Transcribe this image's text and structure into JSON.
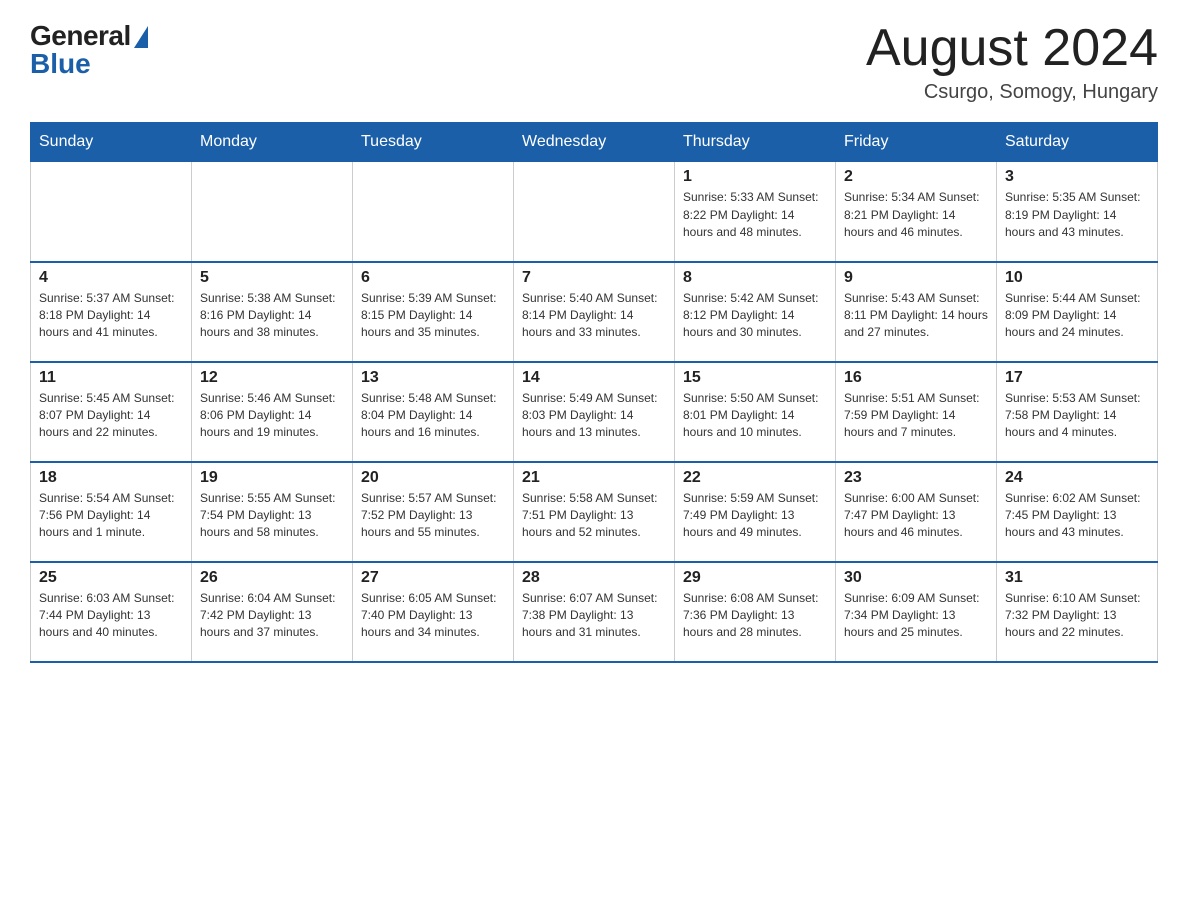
{
  "logo": {
    "general": "General",
    "blue": "Blue"
  },
  "header": {
    "month": "August 2024",
    "location": "Csurgo, Somogy, Hungary"
  },
  "weekdays": [
    "Sunday",
    "Monday",
    "Tuesday",
    "Wednesday",
    "Thursday",
    "Friday",
    "Saturday"
  ],
  "weeks": [
    [
      {
        "day": "",
        "info": ""
      },
      {
        "day": "",
        "info": ""
      },
      {
        "day": "",
        "info": ""
      },
      {
        "day": "",
        "info": ""
      },
      {
        "day": "1",
        "info": "Sunrise: 5:33 AM\nSunset: 8:22 PM\nDaylight: 14 hours\nand 48 minutes."
      },
      {
        "day": "2",
        "info": "Sunrise: 5:34 AM\nSunset: 8:21 PM\nDaylight: 14 hours\nand 46 minutes."
      },
      {
        "day": "3",
        "info": "Sunrise: 5:35 AM\nSunset: 8:19 PM\nDaylight: 14 hours\nand 43 minutes."
      }
    ],
    [
      {
        "day": "4",
        "info": "Sunrise: 5:37 AM\nSunset: 8:18 PM\nDaylight: 14 hours\nand 41 minutes."
      },
      {
        "day": "5",
        "info": "Sunrise: 5:38 AM\nSunset: 8:16 PM\nDaylight: 14 hours\nand 38 minutes."
      },
      {
        "day": "6",
        "info": "Sunrise: 5:39 AM\nSunset: 8:15 PM\nDaylight: 14 hours\nand 35 minutes."
      },
      {
        "day": "7",
        "info": "Sunrise: 5:40 AM\nSunset: 8:14 PM\nDaylight: 14 hours\nand 33 minutes."
      },
      {
        "day": "8",
        "info": "Sunrise: 5:42 AM\nSunset: 8:12 PM\nDaylight: 14 hours\nand 30 minutes."
      },
      {
        "day": "9",
        "info": "Sunrise: 5:43 AM\nSunset: 8:11 PM\nDaylight: 14 hours\nand 27 minutes."
      },
      {
        "day": "10",
        "info": "Sunrise: 5:44 AM\nSunset: 8:09 PM\nDaylight: 14 hours\nand 24 minutes."
      }
    ],
    [
      {
        "day": "11",
        "info": "Sunrise: 5:45 AM\nSunset: 8:07 PM\nDaylight: 14 hours\nand 22 minutes."
      },
      {
        "day": "12",
        "info": "Sunrise: 5:46 AM\nSunset: 8:06 PM\nDaylight: 14 hours\nand 19 minutes."
      },
      {
        "day": "13",
        "info": "Sunrise: 5:48 AM\nSunset: 8:04 PM\nDaylight: 14 hours\nand 16 minutes."
      },
      {
        "day": "14",
        "info": "Sunrise: 5:49 AM\nSunset: 8:03 PM\nDaylight: 14 hours\nand 13 minutes."
      },
      {
        "day": "15",
        "info": "Sunrise: 5:50 AM\nSunset: 8:01 PM\nDaylight: 14 hours\nand 10 minutes."
      },
      {
        "day": "16",
        "info": "Sunrise: 5:51 AM\nSunset: 7:59 PM\nDaylight: 14 hours\nand 7 minutes."
      },
      {
        "day": "17",
        "info": "Sunrise: 5:53 AM\nSunset: 7:58 PM\nDaylight: 14 hours\nand 4 minutes."
      }
    ],
    [
      {
        "day": "18",
        "info": "Sunrise: 5:54 AM\nSunset: 7:56 PM\nDaylight: 14 hours\nand 1 minute."
      },
      {
        "day": "19",
        "info": "Sunrise: 5:55 AM\nSunset: 7:54 PM\nDaylight: 13 hours\nand 58 minutes."
      },
      {
        "day": "20",
        "info": "Sunrise: 5:57 AM\nSunset: 7:52 PM\nDaylight: 13 hours\nand 55 minutes."
      },
      {
        "day": "21",
        "info": "Sunrise: 5:58 AM\nSunset: 7:51 PM\nDaylight: 13 hours\nand 52 minutes."
      },
      {
        "day": "22",
        "info": "Sunrise: 5:59 AM\nSunset: 7:49 PM\nDaylight: 13 hours\nand 49 minutes."
      },
      {
        "day": "23",
        "info": "Sunrise: 6:00 AM\nSunset: 7:47 PM\nDaylight: 13 hours\nand 46 minutes."
      },
      {
        "day": "24",
        "info": "Sunrise: 6:02 AM\nSunset: 7:45 PM\nDaylight: 13 hours\nand 43 minutes."
      }
    ],
    [
      {
        "day": "25",
        "info": "Sunrise: 6:03 AM\nSunset: 7:44 PM\nDaylight: 13 hours\nand 40 minutes."
      },
      {
        "day": "26",
        "info": "Sunrise: 6:04 AM\nSunset: 7:42 PM\nDaylight: 13 hours\nand 37 minutes."
      },
      {
        "day": "27",
        "info": "Sunrise: 6:05 AM\nSunset: 7:40 PM\nDaylight: 13 hours\nand 34 minutes."
      },
      {
        "day": "28",
        "info": "Sunrise: 6:07 AM\nSunset: 7:38 PM\nDaylight: 13 hours\nand 31 minutes."
      },
      {
        "day": "29",
        "info": "Sunrise: 6:08 AM\nSunset: 7:36 PM\nDaylight: 13 hours\nand 28 minutes."
      },
      {
        "day": "30",
        "info": "Sunrise: 6:09 AM\nSunset: 7:34 PM\nDaylight: 13 hours\nand 25 minutes."
      },
      {
        "day": "31",
        "info": "Sunrise: 6:10 AM\nSunset: 7:32 PM\nDaylight: 13 hours\nand 22 minutes."
      }
    ]
  ]
}
